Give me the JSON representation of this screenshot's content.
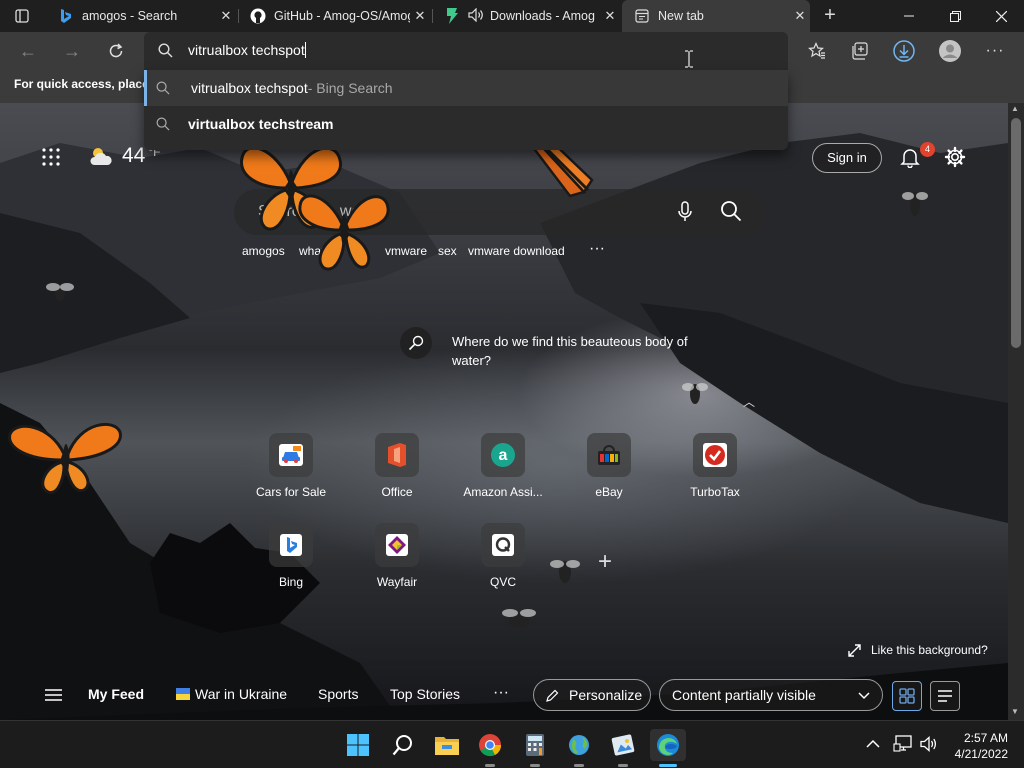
{
  "tabs": [
    {
      "title": "amogos - Search",
      "icon": "bing-icon",
      "active": false
    },
    {
      "title": "GitHub - Amog-OS/Amog",
      "icon": "github-icon",
      "active": false
    },
    {
      "title": "Downloads - Amog",
      "icon": "downloads-site-icon",
      "active": false
    },
    {
      "title": "New tab",
      "icon": "newtab-page-icon",
      "active": true
    }
  ],
  "address_bar": {
    "value": "vitrualbox techspot"
  },
  "suggestions": [
    {
      "text": "vitrualbox techspot",
      "suffix": " - Bing Search",
      "bold": false
    },
    {
      "text": "virtualbox techstream",
      "suffix": "",
      "bold": true
    }
  ],
  "favorites_bar": {
    "text": "For quick access, place your favorites here"
  },
  "weather": {
    "temp": "44",
    "unit": "°F"
  },
  "header": {
    "sign_in": "Sign in",
    "notifications": "4"
  },
  "search": {
    "placeholder": "Search the web",
    "trending": [
      "amogos",
      "what",
      "vmware",
      "sex",
      "vmware download"
    ],
    "more": "···"
  },
  "image_question": "Where do we find this beauteous body of water?",
  "quick_links": [
    {
      "label": "Cars for Sale",
      "icon": "cars-for-sale-icon"
    },
    {
      "label": "Office",
      "icon": "office-icon"
    },
    {
      "label": "Amazon Assi...",
      "icon": "amazon-icon"
    },
    {
      "label": "eBay",
      "icon": "ebay-icon"
    },
    {
      "label": "TurboTax",
      "icon": "turbotax-icon"
    },
    {
      "label": "Bing",
      "icon": "bing-icon"
    },
    {
      "label": "Wayfair",
      "icon": "wayfair-icon"
    },
    {
      "label": "QVC",
      "icon": "qvc-icon"
    }
  ],
  "like_background": "Like this background?",
  "feed": {
    "items": [
      "My Feed",
      "War in Ukraine",
      "Sports",
      "Top Stories"
    ],
    "more": "···",
    "personalize": "Personalize",
    "content_visibility": "Content partially visible"
  },
  "clock": {
    "time": "2:57 AM",
    "date": "4/21/2022"
  },
  "colors": {
    "accent": "#0078d4",
    "badge": "#e1442e",
    "butterfly": "#f07a1a"
  }
}
